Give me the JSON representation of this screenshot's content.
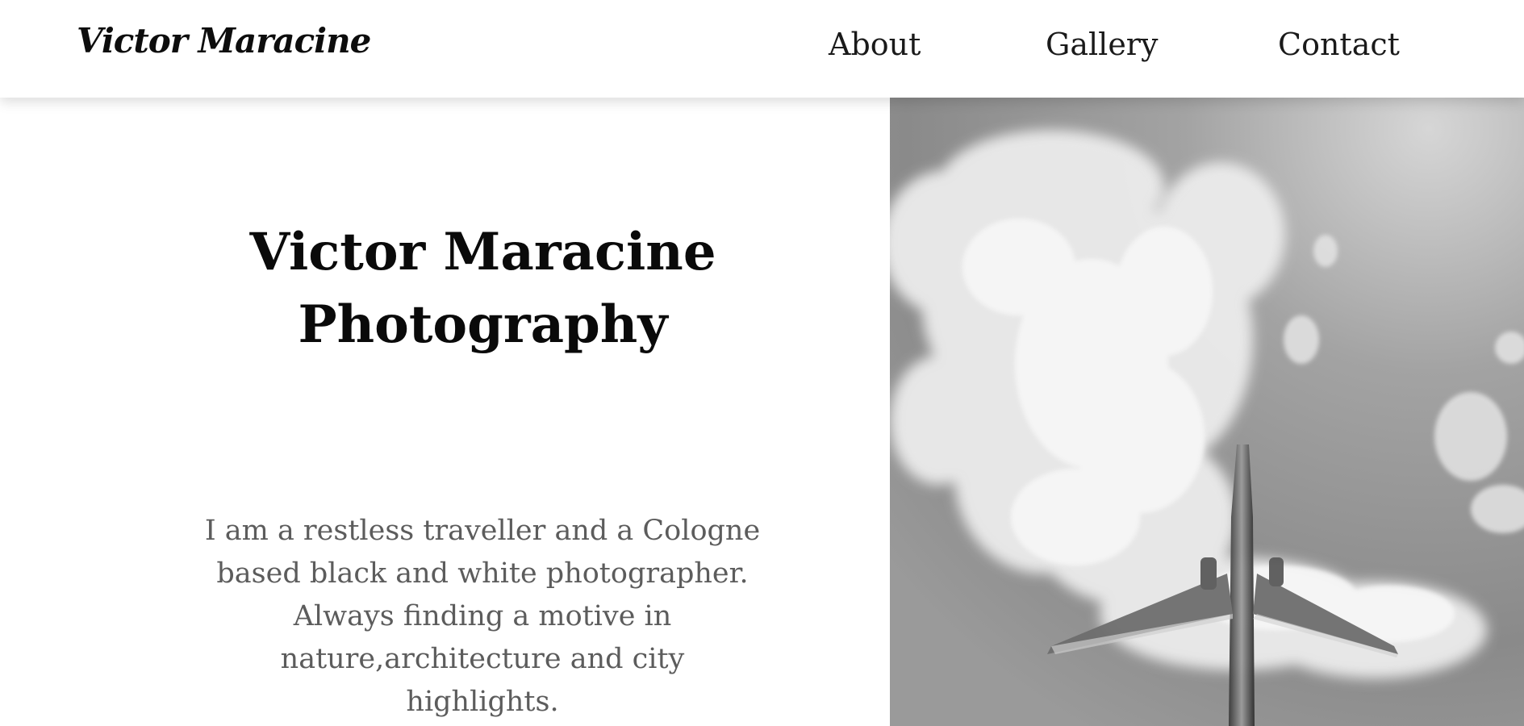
{
  "header": {
    "logo_text": "Victor Maracine",
    "nav": [
      {
        "label": "About"
      },
      {
        "label": "Gallery"
      },
      {
        "label": "Contact"
      }
    ]
  },
  "hero": {
    "title": "Victor Maracine Photography",
    "description": "I am a restless traveller and a Cologne based black and white photographer. Always finding a motive in nature,architecture and city highlights."
  }
}
